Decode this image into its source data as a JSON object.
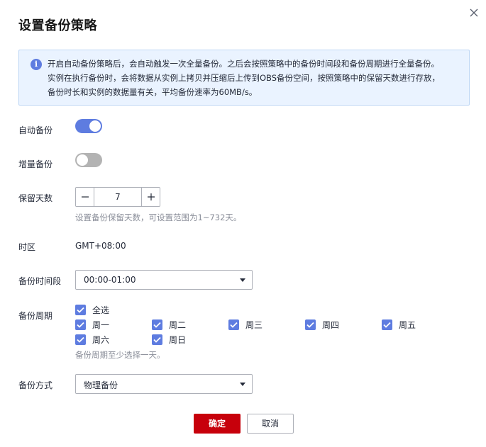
{
  "dialog": {
    "title": "设置备份策略",
    "close_icon": "close-icon"
  },
  "info": {
    "icon": "info-icon",
    "line1": "开启自动备份策略后，会自动触发一次全量备份。之后会按照策略中的备份时间段和备份周期进行全量备份。",
    "line2": "实例在执行备份时，会将数据从实例上拷贝并压缩后上传到OBS备份空间，按照策略中的保留天数进行存放，",
    "line3": "备份时长和实例的数据量有关，平均备份速率为60MB/s。"
  },
  "form": {
    "auto_backup": {
      "label": "自动备份",
      "enabled": true
    },
    "incremental_backup": {
      "label": "增量备份",
      "enabled": false
    },
    "retention": {
      "label": "保留天数",
      "value": "7",
      "hint": "设置备份保留天数，可设置范围为1~732天。"
    },
    "timezone": {
      "label": "时区",
      "value": "GMT+08:00"
    },
    "time_window": {
      "label": "备份时间段",
      "value": "00:00-01:00"
    },
    "period": {
      "label": "备份周期",
      "select_all": "全选",
      "days": [
        "周一",
        "周二",
        "周三",
        "周四",
        "周五",
        "周六",
        "周日"
      ],
      "hint": "备份周期至少选择一天。"
    },
    "method": {
      "label": "备份方式",
      "value": "物理备份"
    }
  },
  "footer": {
    "confirm_label": "确定",
    "cancel_label": "取消"
  },
  "colors": {
    "accent": "#5e7ce0",
    "primary_button": "#c7000b",
    "info_bg": "#eaf3ff"
  }
}
